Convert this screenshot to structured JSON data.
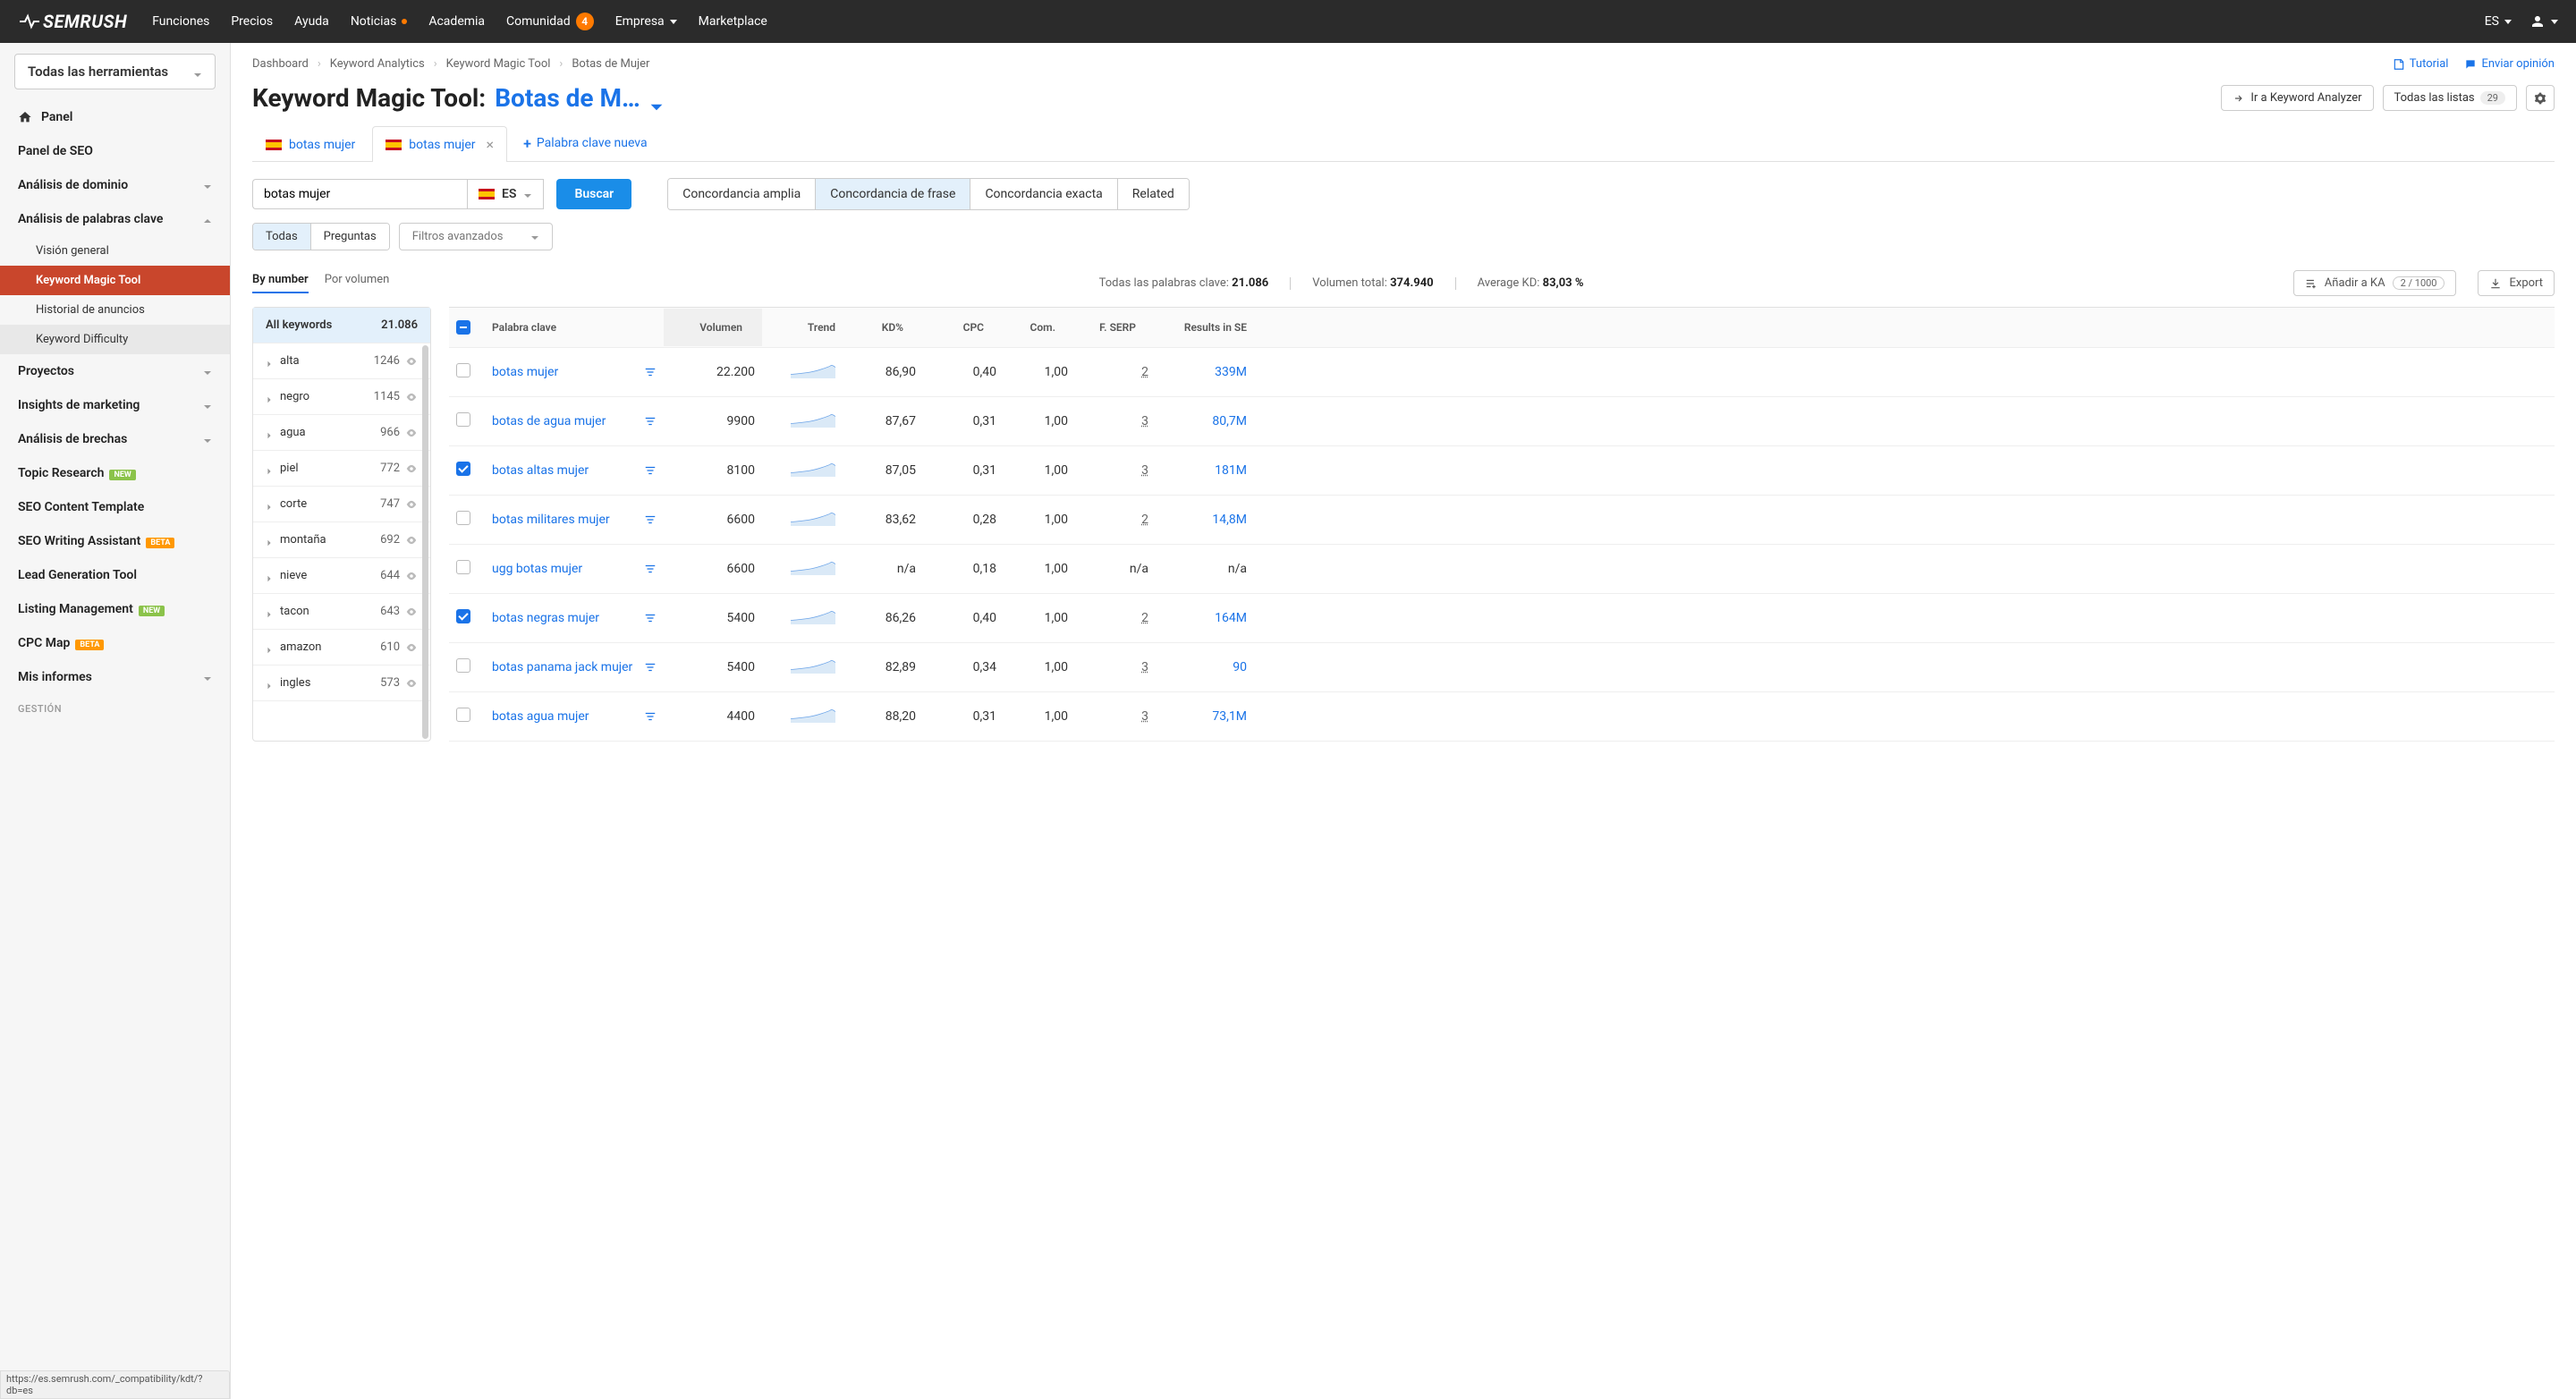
{
  "topnav": {
    "logo": "SEMRUSH",
    "items": [
      "Funciones",
      "Precios",
      "Ayuda",
      "Noticias",
      "Academia",
      "Comunidad",
      "Empresa",
      "Marketplace"
    ],
    "noticias_dot": true,
    "comunidad_badge": "4",
    "lang": "ES"
  },
  "sidebar": {
    "tools_select": "Todas las herramientas",
    "panel": "Panel",
    "items": [
      {
        "label": "Panel de SEO",
        "chevron": false
      },
      {
        "label": "Análisis de dominio",
        "chevron": true
      },
      {
        "label": "Análisis de palabras clave",
        "chevron": true,
        "open": true,
        "subs": [
          {
            "label": "Visión general"
          },
          {
            "label": "Keyword Magic Tool",
            "active": true
          },
          {
            "label": "Historial de anuncios"
          },
          {
            "label": "Keyword Difficulty",
            "hover": true
          }
        ]
      },
      {
        "label": "Proyectos",
        "chevron": true
      },
      {
        "label": "Insights de marketing",
        "chevron": true
      },
      {
        "label": "Análisis de brechas",
        "chevron": true
      },
      {
        "label": "Topic Research",
        "badge": "new"
      },
      {
        "label": "SEO Content Template"
      },
      {
        "label": "SEO Writing Assistant",
        "badge": "beta"
      },
      {
        "label": "Lead Generation Tool"
      },
      {
        "label": "Listing Management",
        "badge": "new"
      },
      {
        "label": "CPC Map",
        "badge": "beta"
      },
      {
        "label": "Mis informes",
        "chevron": true
      }
    ],
    "section_label": "GESTIÓN",
    "status_url": "https://es.semrush.com/_compatibility/kdt/?db=es"
  },
  "breadcrumb": [
    "Dashboard",
    "Keyword Analytics",
    "Keyword Magic Tool",
    "Botas de Mujer"
  ],
  "links": {
    "tutorial": "Tutorial",
    "feedback": "Enviar opinión"
  },
  "title": {
    "prefix": "Keyword Magic Tool:",
    "keyword": "Botas de M…"
  },
  "title_actions": {
    "analyzer": "Ir a Keyword Analyzer",
    "all_lists": "Todas las listas",
    "list_count": "29"
  },
  "tabs": [
    {
      "label": "botas mujer",
      "active": false
    },
    {
      "label": "botas mujer",
      "active": true
    }
  ],
  "tab_new": "Palabra clave nueva",
  "search": {
    "value": "botas mujer",
    "lang": "ES",
    "button": "Buscar"
  },
  "match": [
    "Concordancia amplia",
    "Concordancia de frase",
    "Concordancia exacta",
    "Related"
  ],
  "match_active": 1,
  "filter": {
    "todas": "Todas",
    "preguntas": "Preguntas",
    "advanced": "Filtros avanzados"
  },
  "sort_tabs": [
    "By number",
    "Por volumen"
  ],
  "stats": {
    "total_kw_label": "Todas las palabras clave:",
    "total_kw": "21.086",
    "total_vol_label": "Volumen total:",
    "total_vol": "374.940",
    "avg_kd_label": "Average KD:",
    "avg_kd": "83,03 %"
  },
  "add_ka": {
    "label": "Añadir a KA",
    "count": "2 / 1000"
  },
  "export": "Export",
  "groups": {
    "header": {
      "label": "All keywords",
      "count": "21.086"
    },
    "items": [
      {
        "label": "alta",
        "count": "1246"
      },
      {
        "label": "negro",
        "count": "1145"
      },
      {
        "label": "agua",
        "count": "966"
      },
      {
        "label": "piel",
        "count": "772"
      },
      {
        "label": "corte",
        "count": "747"
      },
      {
        "label": "montaña",
        "count": "692"
      },
      {
        "label": "nieve",
        "count": "644"
      },
      {
        "label": "tacon",
        "count": "643"
      },
      {
        "label": "amazon",
        "count": "610"
      },
      {
        "label": "ingles",
        "count": "573"
      }
    ]
  },
  "columns": [
    "",
    "Palabra clave",
    "Volumen",
    "Trend",
    "KD%",
    "CPC",
    "Com.",
    "F. SERP",
    "Results in SE"
  ],
  "rows": [
    {
      "checked": false,
      "kw": "botas mujer",
      "vol": "22.200",
      "kd": "86,90",
      "cpc": "0,40",
      "com": "1,00",
      "serp": "2",
      "res": "339M"
    },
    {
      "checked": false,
      "kw": "botas de agua mujer",
      "vol": "9900",
      "kd": "87,67",
      "cpc": "0,31",
      "com": "1,00",
      "serp": "3",
      "res": "80,7M"
    },
    {
      "checked": true,
      "kw": "botas altas mujer",
      "vol": "8100",
      "kd": "87,05",
      "cpc": "0,31",
      "com": "1,00",
      "serp": "3",
      "res": "181M"
    },
    {
      "checked": false,
      "kw": "botas militares mujer",
      "vol": "6600",
      "kd": "83,62",
      "cpc": "0,28",
      "com": "1,00",
      "serp": "2",
      "res": "14,8M"
    },
    {
      "checked": false,
      "kw": "ugg botas mujer",
      "vol": "6600",
      "kd": "n/a",
      "cpc": "0,18",
      "com": "1,00",
      "serp": "n/a",
      "res": "n/a",
      "green": true
    },
    {
      "checked": true,
      "kw": "botas negras mujer",
      "vol": "5400",
      "kd": "86,26",
      "cpc": "0,40",
      "com": "1,00",
      "serp": "2",
      "res": "164M"
    },
    {
      "checked": false,
      "kw": "botas panama jack mujer",
      "vol": "5400",
      "kd": "82,89",
      "cpc": "0,34",
      "com": "1,00",
      "serp": "3",
      "res": "90"
    },
    {
      "checked": false,
      "kw": "botas agua mujer",
      "vol": "4400",
      "kd": "88,20",
      "cpc": "0,31",
      "com": "1,00",
      "serp": "3",
      "res": "73,1M"
    }
  ]
}
